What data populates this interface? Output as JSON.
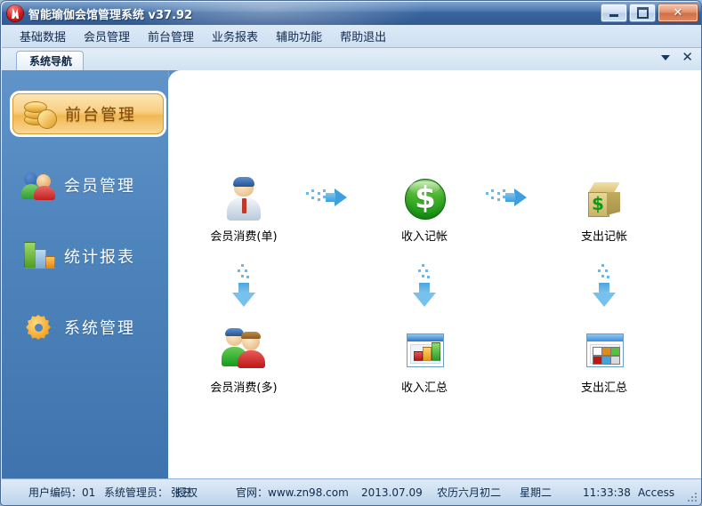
{
  "window": {
    "title": "智能瑜伽会馆管理系统 v37.92",
    "app_icon": "flame-logo-icon",
    "controls": {
      "minimize": "minimize-button",
      "maximize": "maximize-button",
      "close_label": "✕"
    }
  },
  "menubar": {
    "items": [
      {
        "label": "基础数据",
        "name": "menu-basic-data"
      },
      {
        "label": "会员管理",
        "name": "menu-member-management"
      },
      {
        "label": "前台管理",
        "name": "menu-front-desk"
      },
      {
        "label": "业务报表",
        "name": "menu-business-report"
      },
      {
        "label": "辅助功能",
        "name": "menu-aux-function"
      },
      {
        "label": "帮助退出",
        "name": "menu-help-exit"
      }
    ]
  },
  "tabs": {
    "active": "系统导航",
    "dropdown_icon": "chevron-down-icon",
    "close_icon": "✕"
  },
  "sidebar": {
    "items": [
      {
        "label": "前台管理",
        "icon": "coins-icon",
        "active": true
      },
      {
        "label": "会员管理",
        "icon": "two-people-icon",
        "active": false
      },
      {
        "label": "统计报表",
        "icon": "bar-chart-icon",
        "active": false
      },
      {
        "label": "系统管理",
        "icon": "gear-icon",
        "active": false
      }
    ]
  },
  "content": {
    "tiles": [
      {
        "label": "会员消费(单)",
        "icon": "single-person-icon",
        "row": 1,
        "col": 1
      },
      {
        "label": "收入记帐",
        "icon": "green-dollar-coin-icon",
        "row": 1,
        "col": 2
      },
      {
        "label": "支出记帐",
        "icon": "dollar-box-icon",
        "row": 1,
        "col": 3
      },
      {
        "label": "会员消费(多)",
        "icon": "multi-people-icon",
        "row": 2,
        "col": 1
      },
      {
        "label": "收入汇总",
        "icon": "bar-report-window-icon",
        "row": 2,
        "col": 2
      },
      {
        "label": "支出汇总",
        "icon": "grid-report-window-icon",
        "row": 2,
        "col": 3
      }
    ],
    "flow_arrows": [
      {
        "name": "arrow-right-1",
        "direction": "right"
      },
      {
        "name": "arrow-right-2",
        "direction": "right"
      },
      {
        "name": "arrow-down-1",
        "direction": "down"
      },
      {
        "name": "arrow-down-2",
        "direction": "down"
      },
      {
        "name": "arrow-down-3",
        "direction": "down"
      }
    ]
  },
  "statusbar": {
    "user_code": "用户编码：01",
    "admin_label": "系统管理员：",
    "admin_name": "张三",
    "admin_overlay": "授权",
    "website": "官网：www.zn98.com",
    "date": "2013.07.09",
    "lunar": "农历六月初二",
    "weekday": "星期二",
    "time": "11:33:38",
    "database": "Access"
  },
  "colors": {
    "title_blue": "#3f6ea8",
    "body_blue": "#4a80ba",
    "accent_orange": "#f2b853",
    "income_green": "#129a13"
  }
}
